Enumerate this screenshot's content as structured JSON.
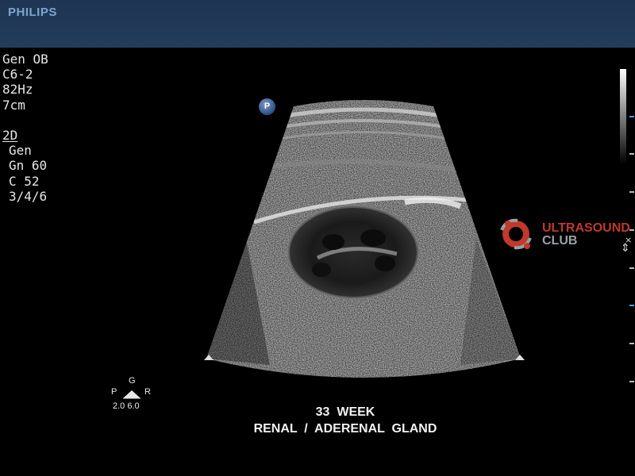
{
  "header": {
    "brand": "PHILIPS"
  },
  "params": {
    "preset": "Gen OB",
    "probe": "C6-2",
    "frame_rate": "82Hz",
    "depth": "7cm",
    "mode": "2D",
    "mode_setting": "Gen",
    "gain": "Gn 60",
    "compression": "C 52",
    "persistence": "3/4/6"
  },
  "probe_marker": {
    "label": "P"
  },
  "watermark": {
    "line1": "ULTRASOUND",
    "line2": "CLUB",
    "color": "#c0392b"
  },
  "orientation": {
    "top": "G",
    "left": "P",
    "right": "R",
    "values": "2.0 6.0"
  },
  "caption": {
    "line1": "33  WEEK",
    "line2": "RENAL  /  ADERENAL  GLAND"
  },
  "colors": {
    "header_bg": "#1e3553",
    "brand": "#7fa3d0",
    "scale_tick": "#4f9ddb"
  }
}
